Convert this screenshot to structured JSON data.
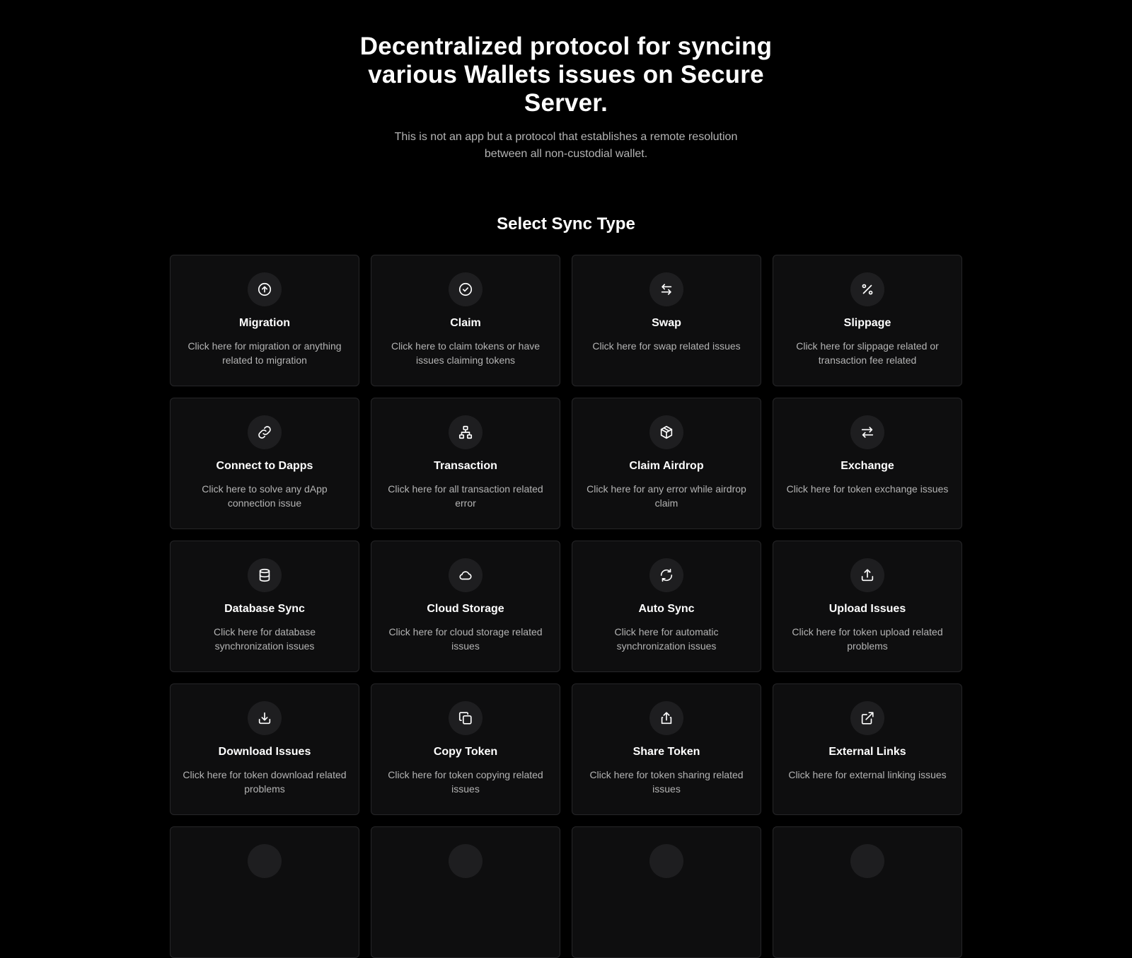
{
  "hero": {
    "title": "Decentralized protocol for syncing various Wallets issues on Secure Server.",
    "subtitle": "This is not an app but a protocol that establishes a remote resolution between all non-custodial wallet."
  },
  "section": {
    "title": "Select Sync Type"
  },
  "cards": [
    {
      "icon": "arrow-up-circle-icon",
      "title": "Migration",
      "desc": "Click here for migration or anything related to migration"
    },
    {
      "icon": "check-circle-icon",
      "title": "Claim",
      "desc": "Click here to claim tokens or have issues claiming tokens"
    },
    {
      "icon": "swap-arrows-icon",
      "title": "Swap",
      "desc": "Click here for swap related issues"
    },
    {
      "icon": "percent-icon",
      "title": "Slippage",
      "desc": "Click here for slippage related or transaction fee related"
    },
    {
      "icon": "link-icon",
      "title": "Connect to Dapps",
      "desc": "Click here to solve any dApp connection issue"
    },
    {
      "icon": "network-icon",
      "title": "Transaction",
      "desc": "Click here for all transaction related error"
    },
    {
      "icon": "package-icon",
      "title": "Claim Airdrop",
      "desc": "Click here for any error while airdrop claim"
    },
    {
      "icon": "exchange-arrows-icon",
      "title": "Exchange",
      "desc": "Click here for token exchange issues"
    },
    {
      "icon": "database-icon",
      "title": "Database Sync",
      "desc": "Click here for database synchronization issues"
    },
    {
      "icon": "cloud-icon",
      "title": "Cloud Storage",
      "desc": "Click here for cloud storage related issues"
    },
    {
      "icon": "refresh-icon",
      "title": "Auto Sync",
      "desc": "Click here for automatic synchronization issues"
    },
    {
      "icon": "upload-icon",
      "title": "Upload Issues",
      "desc": "Click here for token upload related problems"
    },
    {
      "icon": "download-icon",
      "title": "Download Issues",
      "desc": "Click here for token download related problems"
    },
    {
      "icon": "copy-icon",
      "title": "Copy Token",
      "desc": "Click here for token copying related issues"
    },
    {
      "icon": "share-icon",
      "title": "Share Token",
      "desc": "Click here for token sharing related issues"
    },
    {
      "icon": "external-link-icon",
      "title": "External Links",
      "desc": "Click here for external linking issues"
    },
    {
      "icon": "",
      "title": "",
      "desc": ""
    },
    {
      "icon": "",
      "title": "",
      "desc": ""
    },
    {
      "icon": "",
      "title": "",
      "desc": ""
    },
    {
      "icon": "",
      "title": "",
      "desc": ""
    }
  ]
}
